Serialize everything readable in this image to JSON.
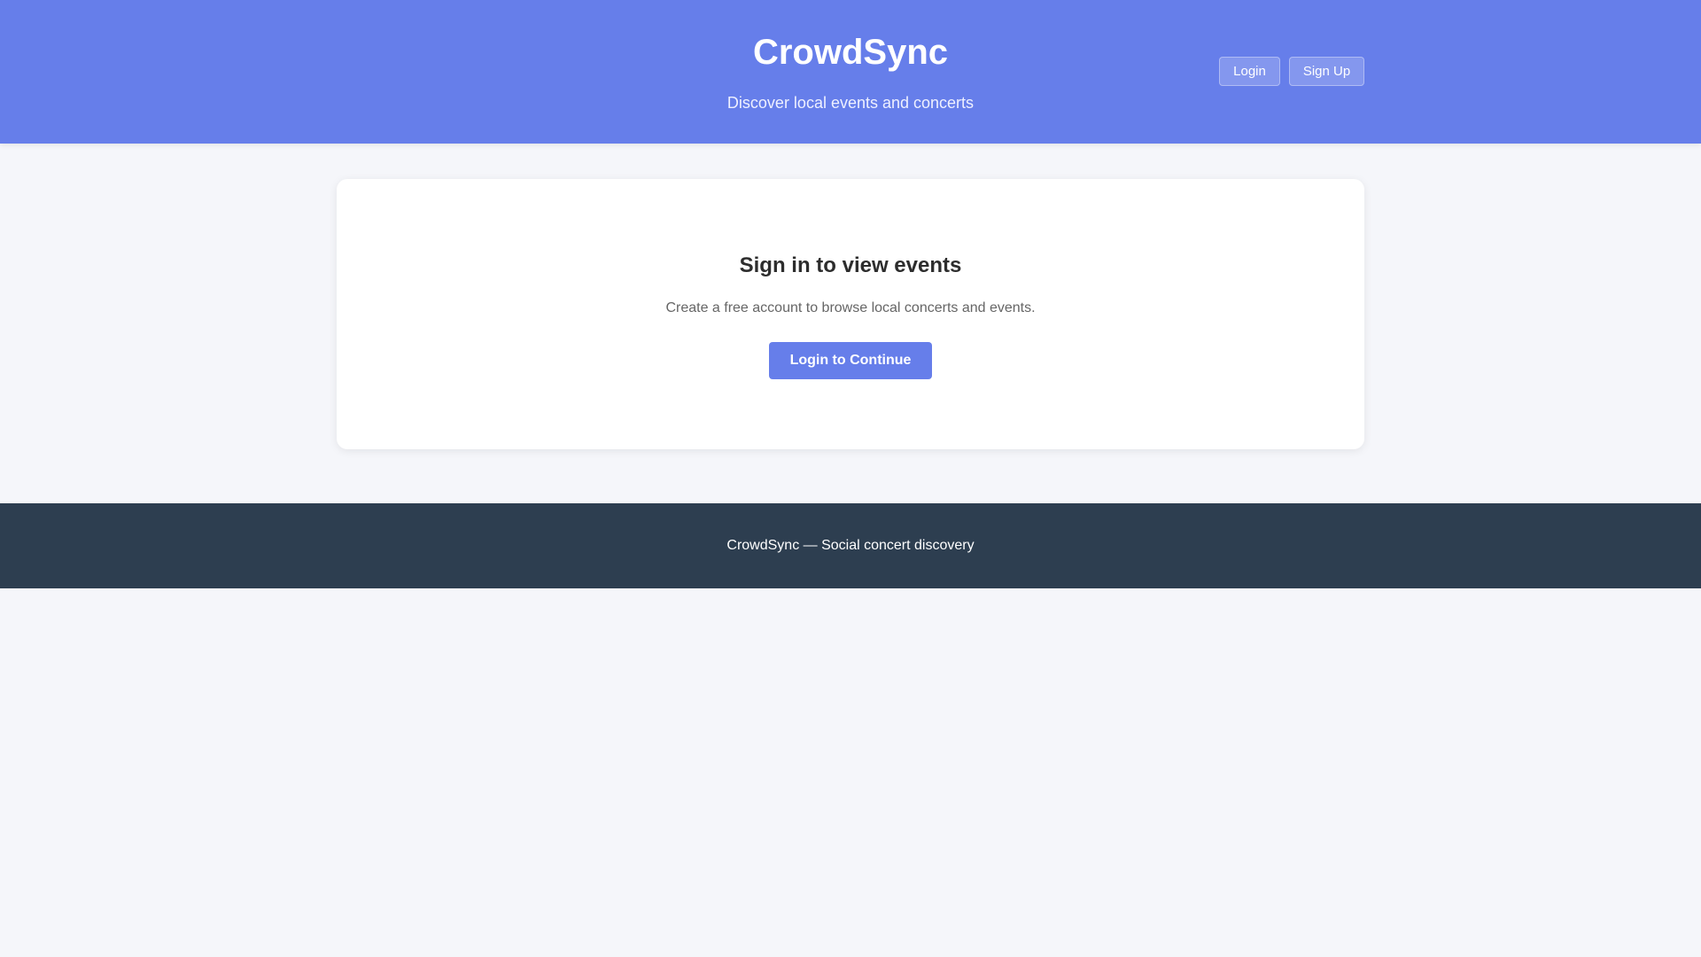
{
  "header": {
    "title": "CrowdSync",
    "subtitle": "Discover local events and concerts",
    "login_label": "Login",
    "signup_label": "Sign Up"
  },
  "card": {
    "heading": "Sign in to view events",
    "text": "Create a free account to browse local concerts and events.",
    "button_label": "Login to Continue"
  },
  "footer": {
    "text": "CrowdSync — Social concert discovery"
  },
  "colors": {
    "accent": "#667eea",
    "footer": "#2d3e50",
    "background": "#f5f6fa"
  }
}
